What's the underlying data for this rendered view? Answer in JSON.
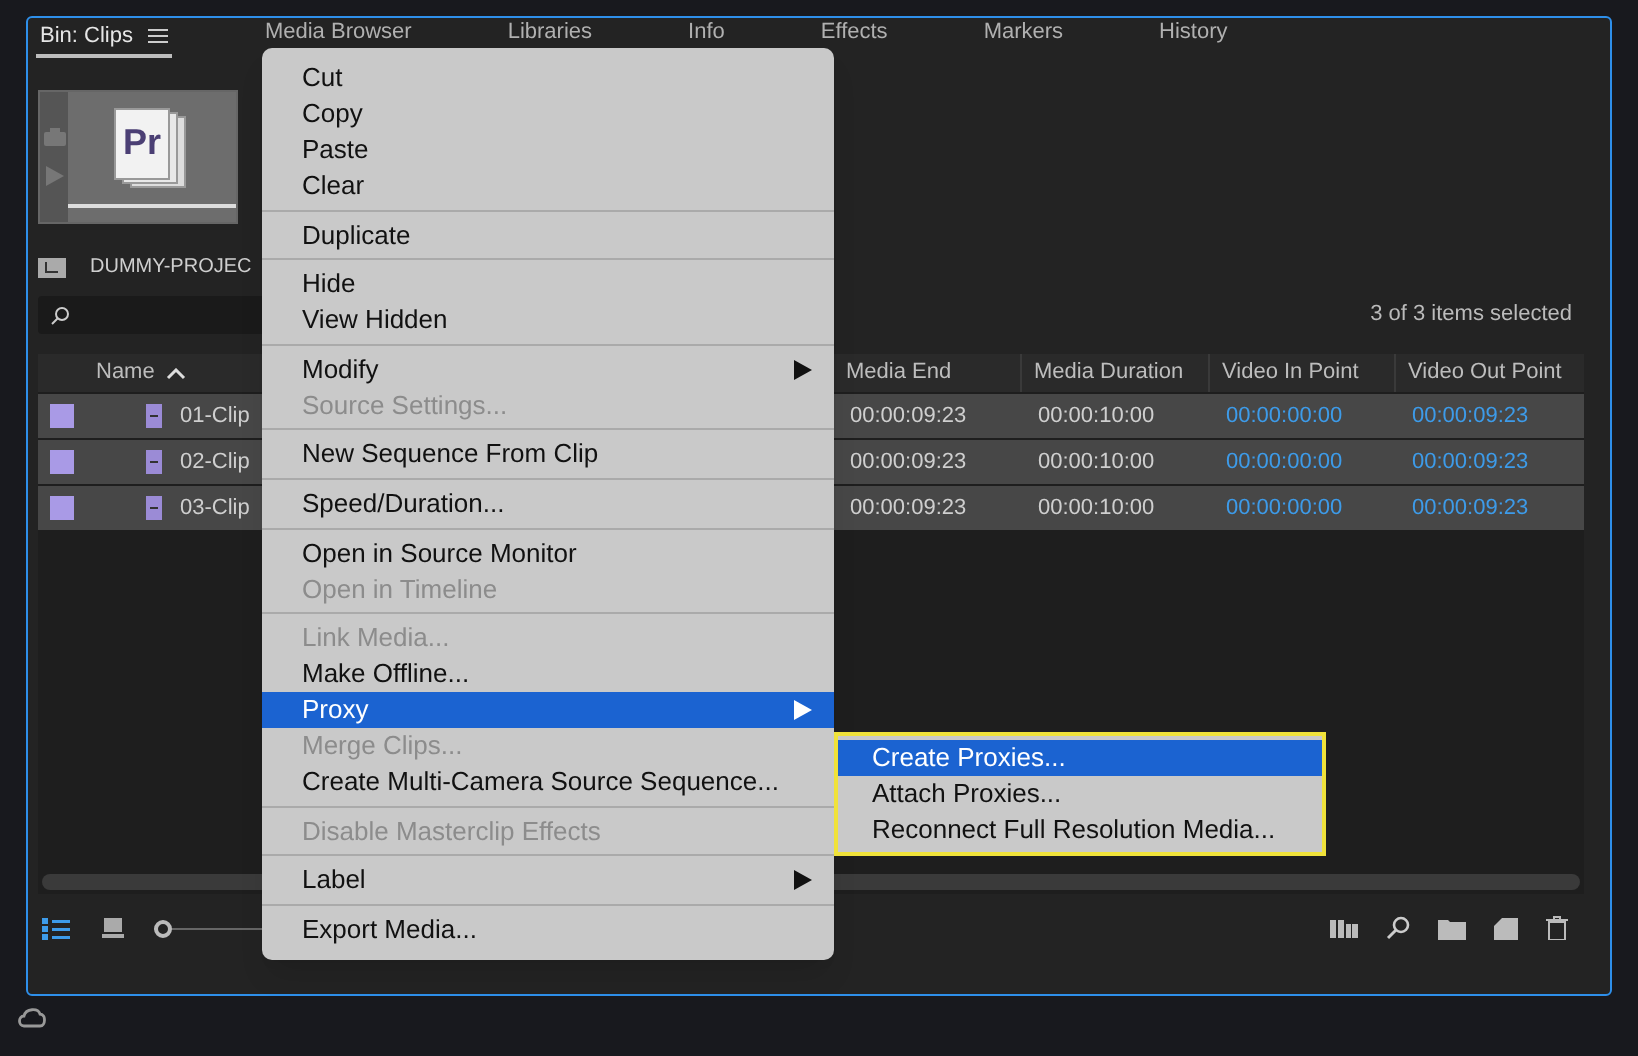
{
  "tabs": [
    {
      "label": "Bin: Clips",
      "selected": true
    },
    {
      "label": "Media Browser",
      "selected": false
    },
    {
      "label": "Libraries",
      "selected": false
    },
    {
      "label": "Info",
      "selected": false
    },
    {
      "label": "Effects",
      "selected": false
    },
    {
      "label": "Markers",
      "selected": false
    },
    {
      "label": "History",
      "selected": false
    }
  ],
  "thumbnail": {
    "logo": "Pr"
  },
  "breadcrumb": "DUMMY-PROJEC",
  "zoom_slider": {
    "level": 0
  },
  "selection_count": "3 of 3 items selected",
  "table": {
    "columns": [
      "Name",
      "Media End",
      "Media Duration",
      "Video In Point",
      "Video Out Point"
    ],
    "rows": [
      {
        "color": "#a99ae6",
        "name": "01-Clip",
        "media_end": "00:00:09:23",
        "media_duration": "00:00:10:00",
        "video_in": "00:00:00:00",
        "video_out": "00:00:09:23",
        "selected": true
      },
      {
        "color": "#a99ae6",
        "name": "02-Clip",
        "media_end": "00:00:09:23",
        "media_duration": "00:00:10:00",
        "video_in": "00:00:00:00",
        "video_out": "00:00:09:23",
        "selected": true
      },
      {
        "color": "#a99ae6",
        "name": "03-Clip",
        "media_end": "00:00:09:23",
        "media_duration": "00:00:10:00",
        "video_in": "00:00:00:00",
        "video_out": "00:00:09:23",
        "selected": true
      }
    ]
  },
  "context_menu": {
    "sections": [
      [
        {
          "label": "Cut",
          "disabled": false,
          "submenu": false,
          "selected": false
        },
        {
          "label": "Copy",
          "disabled": false,
          "submenu": false,
          "selected": false
        },
        {
          "label": "Paste",
          "disabled": false,
          "submenu": false,
          "selected": false
        },
        {
          "label": "Clear",
          "disabled": false,
          "submenu": false,
          "selected": false
        }
      ],
      [
        {
          "label": "Duplicate",
          "disabled": false,
          "submenu": false,
          "selected": false
        }
      ],
      [
        {
          "label": "Hide",
          "disabled": false,
          "submenu": false,
          "selected": false
        },
        {
          "label": "View Hidden",
          "disabled": false,
          "submenu": false,
          "selected": false
        }
      ],
      [
        {
          "label": "Modify",
          "disabled": false,
          "submenu": true,
          "selected": false
        },
        {
          "label": "Source Settings...",
          "disabled": true,
          "submenu": false,
          "selected": false
        }
      ],
      [
        {
          "label": "New Sequence From Clip",
          "disabled": false,
          "submenu": false,
          "selected": false
        }
      ],
      [
        {
          "label": "Speed/Duration...",
          "disabled": false,
          "submenu": false,
          "selected": false
        }
      ],
      [
        {
          "label": "Open in Source Monitor",
          "disabled": false,
          "submenu": false,
          "selected": false
        },
        {
          "label": "Open in Timeline",
          "disabled": true,
          "submenu": false,
          "selected": false
        }
      ],
      [
        {
          "label": "Link Media...",
          "disabled": true,
          "submenu": false,
          "selected": false
        },
        {
          "label": "Make Offline...",
          "disabled": false,
          "submenu": false,
          "selected": false
        },
        {
          "label": "Proxy",
          "disabled": false,
          "submenu": true,
          "selected": true
        },
        {
          "label": "Merge Clips...",
          "disabled": true,
          "submenu": false,
          "selected": false
        },
        {
          "label": "Create Multi-Camera Source Sequence...",
          "disabled": false,
          "submenu": false,
          "selected": false
        }
      ],
      [
        {
          "label": "Disable Masterclip Effects",
          "disabled": true,
          "submenu": false,
          "selected": false
        }
      ],
      [
        {
          "label": "Label",
          "disabled": false,
          "submenu": true,
          "selected": false
        }
      ],
      [
        {
          "label": "Export Media...",
          "disabled": false,
          "submenu": false,
          "selected": false
        }
      ]
    ]
  },
  "submenu": {
    "items": [
      {
        "label": "Create Proxies...",
        "selected": true
      },
      {
        "label": "Attach Proxies...",
        "selected": false
      },
      {
        "label": "Reconnect Full Resolution Media...",
        "selected": false
      }
    ]
  }
}
